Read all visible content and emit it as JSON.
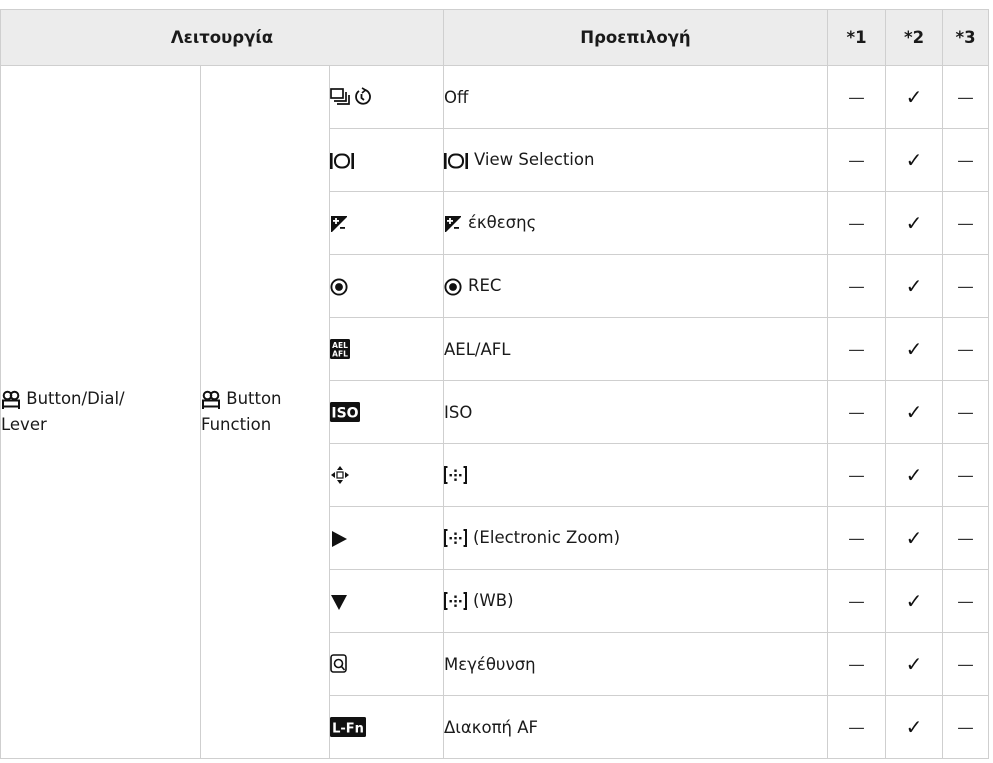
{
  "headers": {
    "function": "Λειτουργία",
    "option": "Προεπιλογή",
    "col1": "*1",
    "col2": "*2",
    "col3": "*3"
  },
  "category": {
    "icon": "movie-icon",
    "label": "Button/Dial/\nLever"
  },
  "subcategory": {
    "icon": "movie-icon",
    "label": "Button\nFunction"
  },
  "rows": [
    {
      "icon": "drive-selftimer-icon",
      "text": "Off",
      "c1": "—",
      "c2": "✓",
      "c3": "—"
    },
    {
      "icon": "view-selection-icon",
      "text": "View Selection",
      "c1": "—",
      "c2": "✓",
      "c3": "—"
    },
    {
      "icon": "exposure-compensation-icon",
      "text": "έκθεσης",
      "c1": "—",
      "c2": "✓",
      "c3": "—"
    },
    {
      "icon": "rec-icon",
      "text": "REC",
      "c1": "—",
      "c2": "✓",
      "c3": "—"
    },
    {
      "icon": "ael-afl-icon",
      "text": "AEL/AFL",
      "c1": "—",
      "c2": "✓",
      "c3": "—"
    },
    {
      "icon": "iso-icon",
      "text": "ISO",
      "c1": "—",
      "c2": "✓",
      "c3": "—"
    },
    {
      "icon": "arrow-pad-icon",
      "text": "",
      "c1": "—",
      "c2": "✓",
      "c3": "—"
    },
    {
      "icon": "play-right-icon",
      "text": "(Electronic Zoom)",
      "c1": "—",
      "c2": "✓",
      "c3": "—"
    },
    {
      "icon": "triangle-down-icon",
      "text": "(WB)",
      "c1": "—",
      "c2": "✓",
      "c3": "—"
    },
    {
      "icon": "magnify-icon",
      "text": "Μεγέθυνση",
      "c1": "—",
      "c2": "✓",
      "c3": "—"
    },
    {
      "icon": "l-fn-icon",
      "text": "Διακοπή AF",
      "c1": "—",
      "c2": "✓",
      "c3": "—"
    }
  ]
}
